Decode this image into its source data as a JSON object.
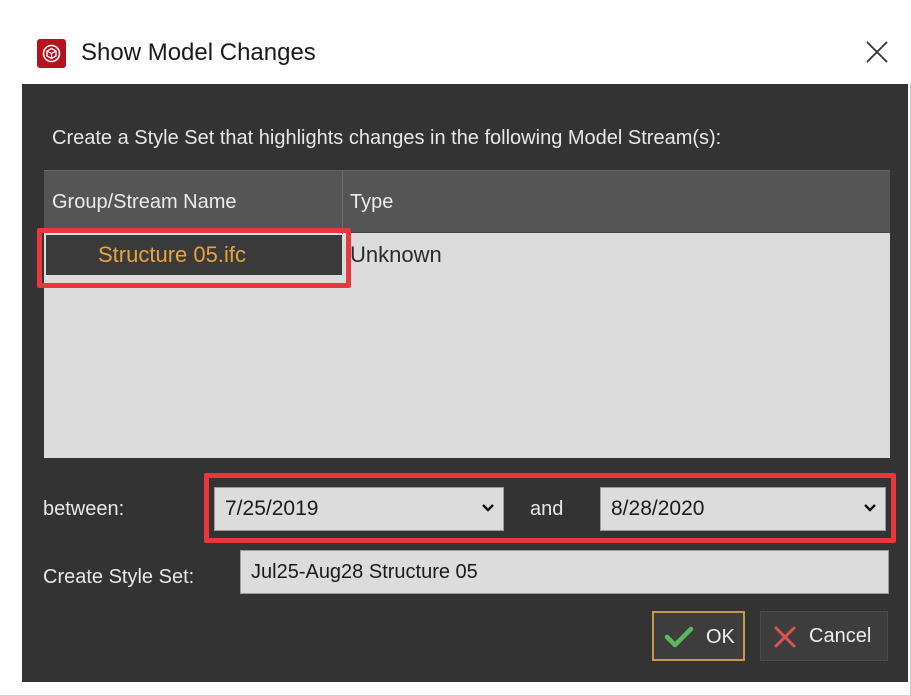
{
  "window": {
    "title": "Show Model Changes",
    "app_icon": "app-logo-icon",
    "close_icon": "close-icon"
  },
  "dialog": {
    "prompt": "Create a Style Set that highlights changes in the following Model Stream(s):",
    "table": {
      "columns": [
        "Group/Stream Name",
        "Type"
      ],
      "rows": [
        {
          "name": "Structure 05.ifc",
          "type": "Unknown"
        }
      ]
    },
    "between_label": "between:",
    "from_date": "7/25/2019",
    "and_label": "and",
    "to_date": "8/28/2020",
    "style_set_label": "Create Style Set:",
    "style_set_value": "Jul25-Aug28 Structure 05",
    "ok_label": "OK",
    "cancel_label": "Cancel"
  },
  "colors": {
    "background": "#333333",
    "selected_text": "#e8a33c",
    "highlight": "#e8383d",
    "ok_check": "#5cb85c",
    "cancel_x": "#d9534f",
    "app_icon_bg": "#b5121b"
  }
}
